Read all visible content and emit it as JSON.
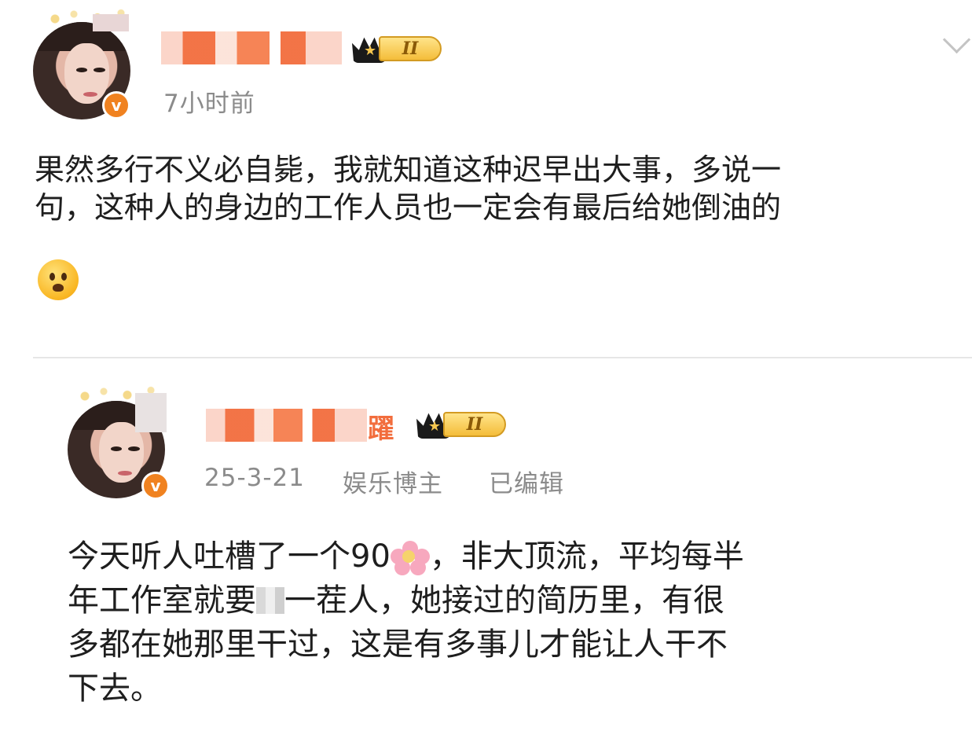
{
  "post1": {
    "author_name_visible_fragment": "",
    "timestamp": "7小时前",
    "vip_level": "II",
    "verified_mark": "v",
    "content_lines": [
      "果然多行不义必自毙，我就知道这种迟早出大事，多说一",
      "句，这种人的身边的工作人员也一定会有最后给她倒油的"
    ],
    "emoji": "frowning-face"
  },
  "repost": {
    "author_name_visible_fragment": "躍",
    "date": "25-3-21",
    "category": "娱乐博主",
    "edited": "已编辑",
    "vip_level": "II",
    "verified_mark": "v",
    "content_lines": [
      "今天听人吐槽了一个90",
      "，非大顶流，平均每半",
      "年工作室就要",
      "一茬人，她接过的简历里，有很",
      "多都在她那里干过，这是有多事儿才能让人干不",
      "下去。"
    ],
    "inline_emoji": "cherry-blossom"
  },
  "colors": {
    "accent": "#f08220",
    "name_orange": "#f26d3d",
    "meta_gray": "#8b8b8b",
    "vip_gold": "#f4bd3a"
  }
}
